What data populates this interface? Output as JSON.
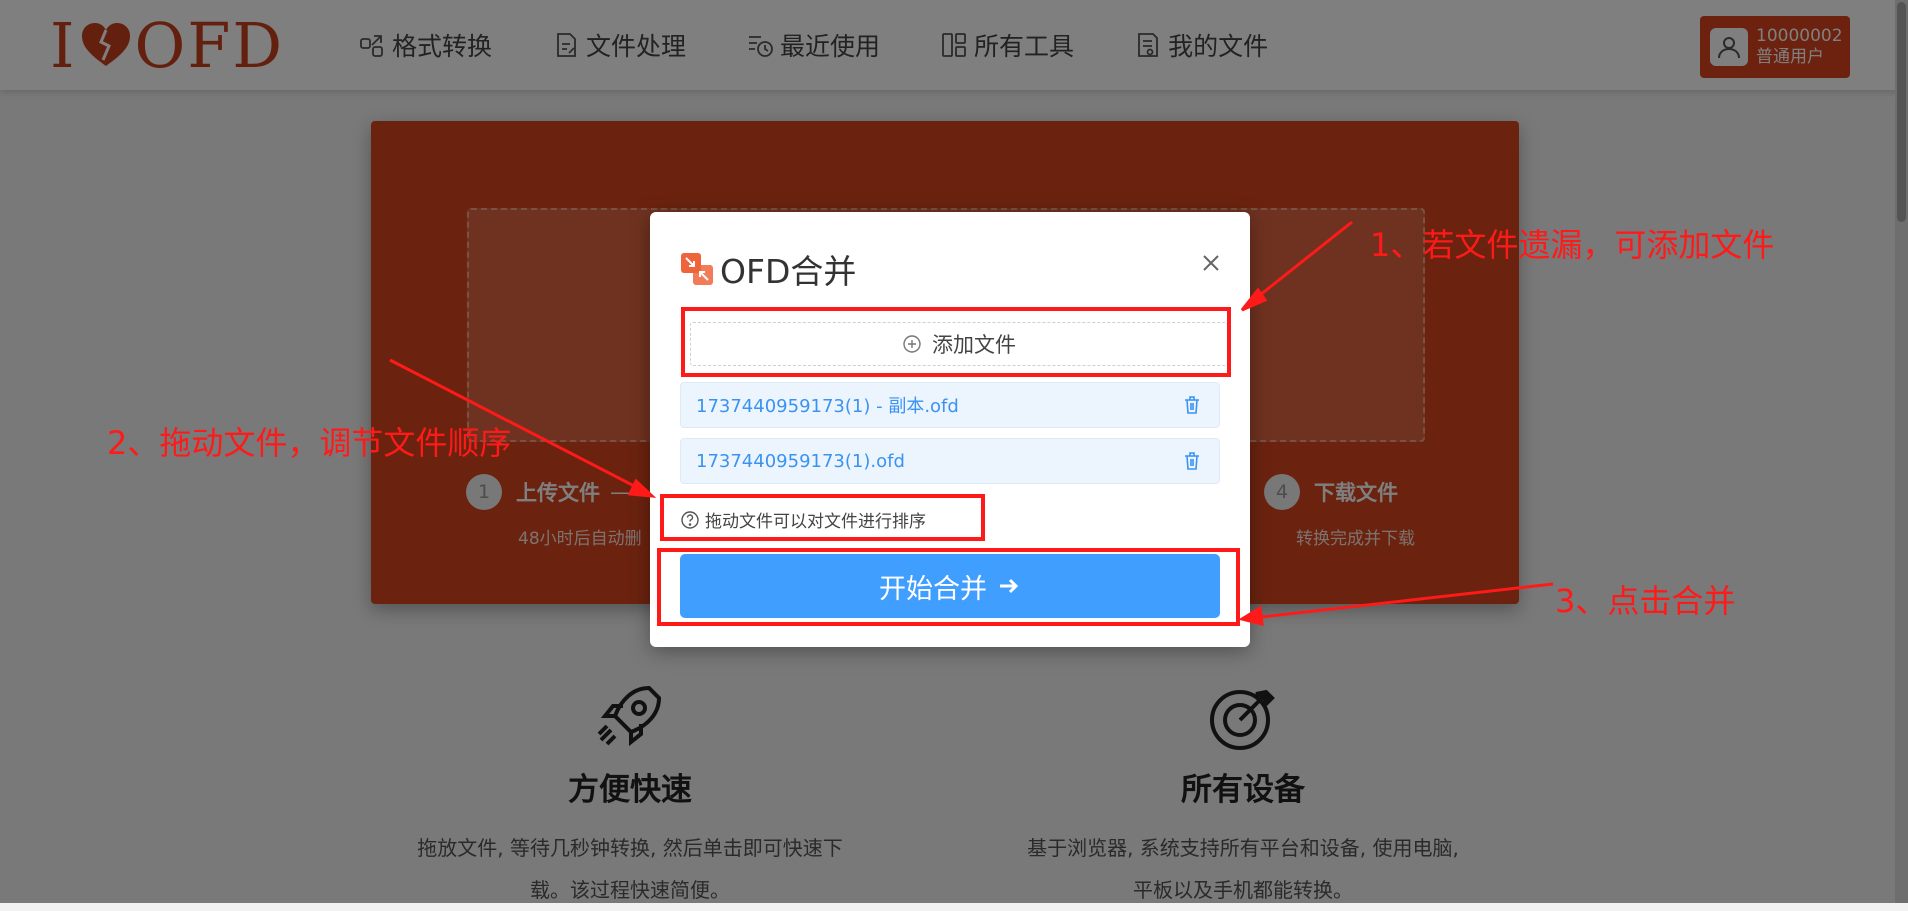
{
  "header": {
    "logo": {
      "left": "I",
      "right": "OFD"
    },
    "nav": [
      {
        "label": "格式转换",
        "icon": "convert-icon"
      },
      {
        "label": "文件处理",
        "icon": "file-edit-icon"
      },
      {
        "label": "最近使用",
        "icon": "recent-icon"
      },
      {
        "label": "所有工具",
        "icon": "tools-grid-icon"
      },
      {
        "label": "我的文件",
        "icon": "my-files-icon"
      }
    ],
    "user": {
      "id": "10000002",
      "role": "普通用户"
    }
  },
  "hero": {
    "steps": [
      {
        "num": "1",
        "title": "上传文件",
        "dash": "—",
        "desc": "48小时后自动删"
      },
      {
        "num": "4",
        "title": "下载文件",
        "desc": "转换完成并下载"
      }
    ]
  },
  "features": [
    {
      "title": "方便快速",
      "desc_line1": "拖放文件, 等待几秒钟转换, 然后单击即可快速下",
      "desc_line2": "载。该过程快速简便。",
      "icon": "rocket-icon"
    },
    {
      "title": "所有设备",
      "desc_line1": "基于浏览器, 系统支持所有平台和设备, 使用电脑,",
      "desc_line2": "平板以及手机都能转换。",
      "icon": "target-icon"
    }
  ],
  "modal": {
    "title": "OFD合并",
    "add_file_label": "添加文件",
    "files": [
      {
        "name": "1737440959173(1) - 副本.ofd"
      },
      {
        "name": "1737440959173(1).ofd"
      }
    ],
    "hint": "拖动文件可以对文件进行排序",
    "start_label": "开始合并"
  },
  "annotations": [
    {
      "text": "1、若文件遗漏，可添加文件"
    },
    {
      "text": "2、拖动文件，调节文件顺序"
    },
    {
      "text": "3、点击合并"
    }
  ],
  "colors": {
    "brand": "#d9441f",
    "primary_button": "#409eff",
    "file_item_bg": "#ecf4fe",
    "file_text": "#3a93f2",
    "annotation": "#ff1a1a"
  }
}
